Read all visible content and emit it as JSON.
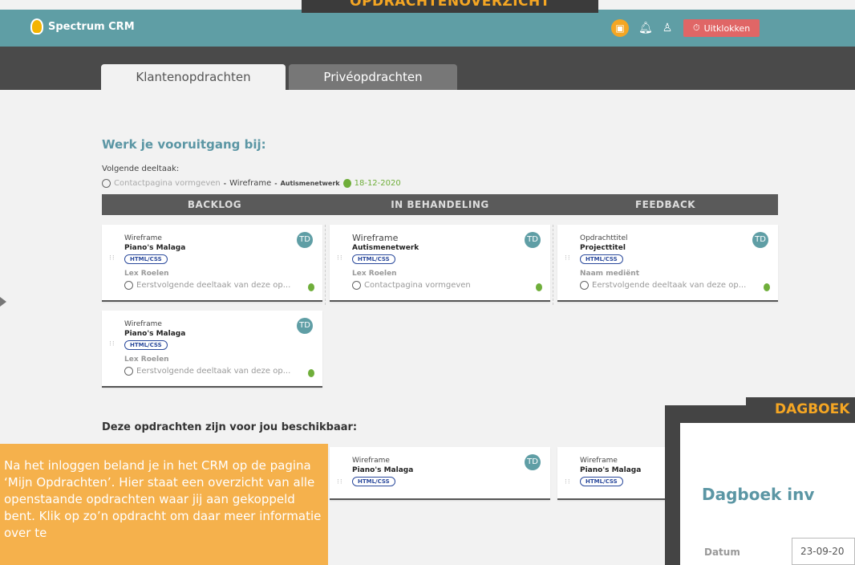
{
  "app": {
    "name": "Spectrum CRM",
    "brand_color": "#5f9ea5"
  },
  "banner_top": "OPDRACHTENOVERZICHT",
  "header_actions": {
    "calendar_icon": "calendar-icon",
    "bell_icon": "bell-icon",
    "user_icon": "user-icon",
    "clock_out_label": "Uitklokken"
  },
  "tabs": [
    {
      "label": "Klantenopdrachten",
      "active": true
    },
    {
      "label": "Privéopdrachten",
      "active": false
    }
  ],
  "progress": {
    "title": "Werk je vooruitgang bij:",
    "next_label": "Volgende deeltaak:",
    "next_task": "Contactpagina vormgeven",
    "next_type": "Wireframe",
    "next_project": "Autismenetwerk",
    "next_date": "18-12-2020",
    "separator": "-"
  },
  "columns": [
    "BACKLOG",
    "IN BEHANDELING",
    "FEEDBACK"
  ],
  "cards": [
    {
      "type": "Wireframe",
      "project": "Piano's Malaga",
      "tag": "HTML/CSS",
      "person": "Lex Roelen",
      "task": "Eerstvolgende deeltaak van deze op...",
      "avatar": "TD"
    },
    {
      "type": "Wireframe",
      "project": "Autismenetwerk",
      "tag": "HTML/CSS",
      "person": "Lex Roelen",
      "task": "Contactpagina vormgeven",
      "avatar": "TD"
    },
    {
      "type": "Opdrachttitel",
      "project": "Projecttitel",
      "tag": "HTML/CSS",
      "person": "Naam mediënt",
      "task": "Eerstvolgende deeltaak van deze op...",
      "avatar": "TD"
    },
    {
      "type": "Wireframe",
      "project": "Piano's Malaga",
      "tag": "HTML/CSS",
      "person": "Lex Roelen",
      "task": "Eerstvolgende deeltaak van deze op...",
      "avatar": "TD"
    }
  ],
  "available": {
    "title": "Deze opdrachten zijn voor jou beschikbaar:",
    "cards": [
      {
        "type": "Wireframe",
        "project": "Piano's Malaga",
        "tag": "HTML/CSS",
        "avatar": "TD"
      },
      {
        "type": "Wireframe",
        "project": "Piano's Malaga",
        "tag": "HTML/CSS"
      }
    ]
  },
  "note": "Na het inloggen beland je in het CRM op de pagina ‘Mijn Opdrachten’. Hier staat een overzicht van alle openstaande opdrachten waar jij aan gekoppeld bent. Klik op zo’n opdracht om daar meer informatie over te",
  "dagboek": {
    "banner": "DAGBOEK",
    "title": "Dagboek inv",
    "date_label": "Datum",
    "date_value": "23-09-20"
  }
}
